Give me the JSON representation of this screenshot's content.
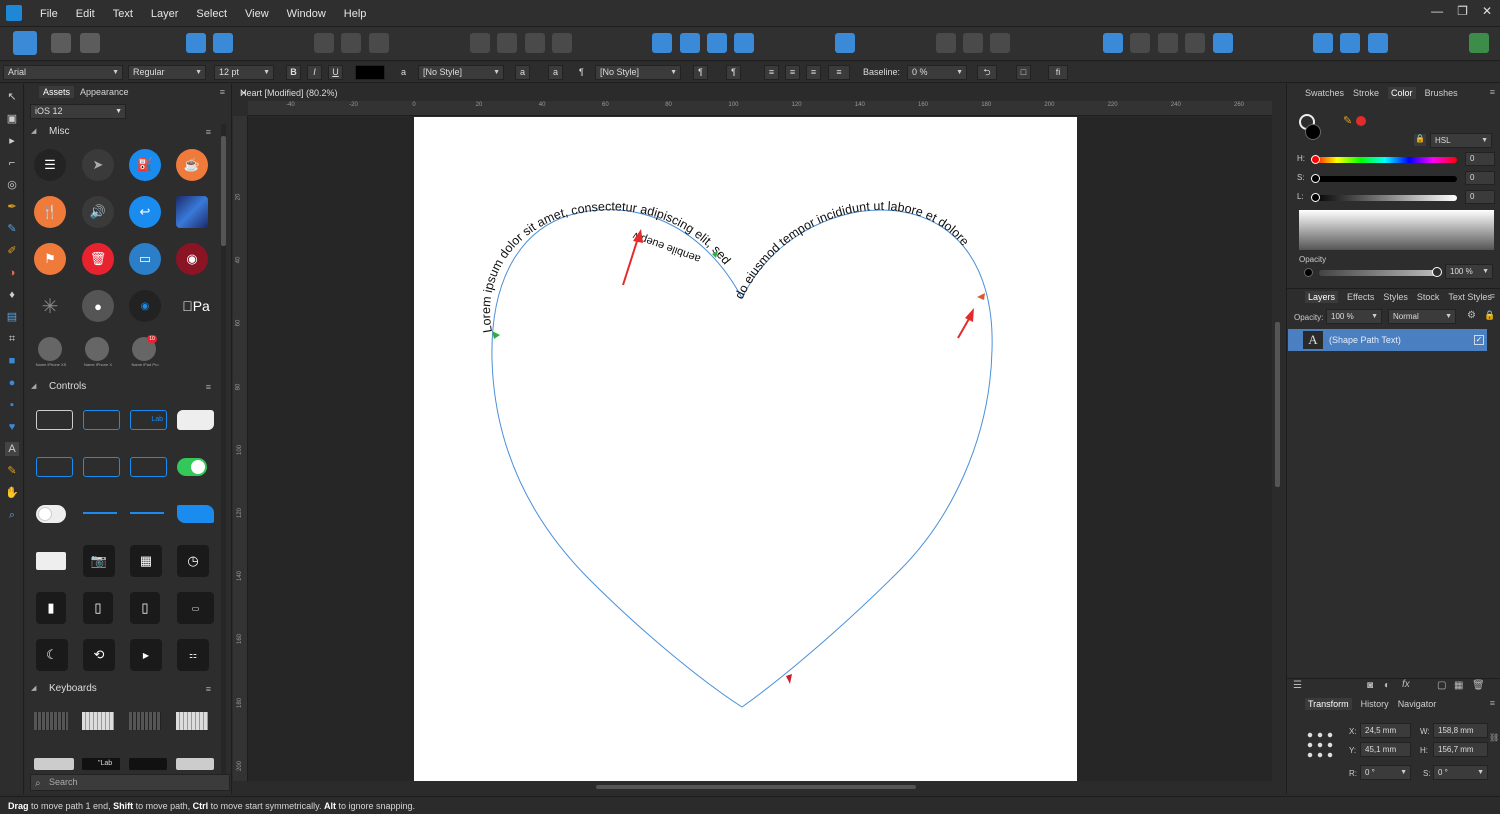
{
  "menu": [
    "File",
    "Edit",
    "Text",
    "Layer",
    "Select",
    "View",
    "Window",
    "Help"
  ],
  "window_controls": [
    "—",
    "❐",
    "✕"
  ],
  "context": {
    "font_family": "Arial",
    "font_style": "Regular",
    "font_size": "12 pt",
    "bold": "B",
    "italic": "I",
    "underline": "U",
    "char_style": "[No Style]",
    "para_style": "[No Style]",
    "lowercase_a": "a",
    "pilcrow": "¶",
    "baseline_label": "Baseline:",
    "baseline_value": "0 %",
    "fi_ligature": "fi"
  },
  "assets": {
    "tabs": [
      "Assets",
      "Appearance"
    ],
    "source": "iOS 12",
    "sections": [
      "Misc",
      "Controls",
      "Keyboards"
    ],
    "misc_labels": [
      "Name iPhone XS",
      "Name iPhone X",
      "Name iPad Pro"
    ],
    "apple_pay": "Pa",
    "badge_count": "10",
    "control_labels": [
      "Lab"
    ],
    "keyboard_label": "\"Lab",
    "search_placeholder": "Search"
  },
  "document": {
    "title": "Heart [Modified] (80.2%)",
    "ruler_h": [
      "-40",
      "-20",
      "0",
      "20",
      "40",
      "60",
      "80",
      "100",
      "120",
      "140",
      "160",
      "180",
      "200",
      "220",
      "240",
      "260"
    ],
    "ruler_v": [
      "20",
      "40",
      "60",
      "80",
      "100",
      "120",
      "140",
      "160",
      "180",
      "200"
    ],
    "text_left": "Lorem ipsum dolor sit amet, consectetur adipiscing elit, sed",
    "text_right": "do eiusmod tempor incididunt ut labore et dolore",
    "text_overlap": "aenbile euepw"
  },
  "right": {
    "color_tabs": [
      "Swatches",
      "Stroke",
      "Color",
      "Brushes"
    ],
    "color_model": "HSL",
    "h_label": "H:",
    "h_value": "0",
    "s_label": "S:",
    "s_value": "0",
    "l_label": "L:",
    "l_value": "0",
    "opacity_label": "Opacity",
    "opacity_value": "100 %",
    "layer_tabs": [
      "Layers",
      "Effects",
      "Styles",
      "Stock",
      "Text Styles"
    ],
    "layer_opacity_label": "Opacity:",
    "layer_opacity_value": "100 %",
    "blend_mode": "Normal",
    "layer_name": "(Shape Path Text)",
    "transform_tabs": [
      "Transform",
      "History",
      "Navigator"
    ],
    "x_label": "X:",
    "x_value": "24,5 mm",
    "y_label": "Y:",
    "y_value": "45,1 mm",
    "w_label": "W:",
    "w_value": "158,8 mm",
    "h2_label": "H:",
    "h2_value": "156,7 mm",
    "r_label": "R:",
    "r_value": "0 °",
    "sk_label": "S:",
    "sk_value": "0 °"
  },
  "status": {
    "k1": "Drag",
    "t1": " to move path 1 end, ",
    "k2": "Shift",
    "t2": " to move path, ",
    "k3": "Ctrl",
    "t3": " to move start symmetrically. ",
    "k4": "Alt",
    "t4": " to ignore snapping."
  },
  "colors": {
    "accent": "#3a8ad8",
    "path": "#4a90d9",
    "arrow": "#e32b2b",
    "start_handle": "#2fae3c",
    "end_handle": "#e0582a",
    "layer_selected": "#4a7fc1"
  }
}
